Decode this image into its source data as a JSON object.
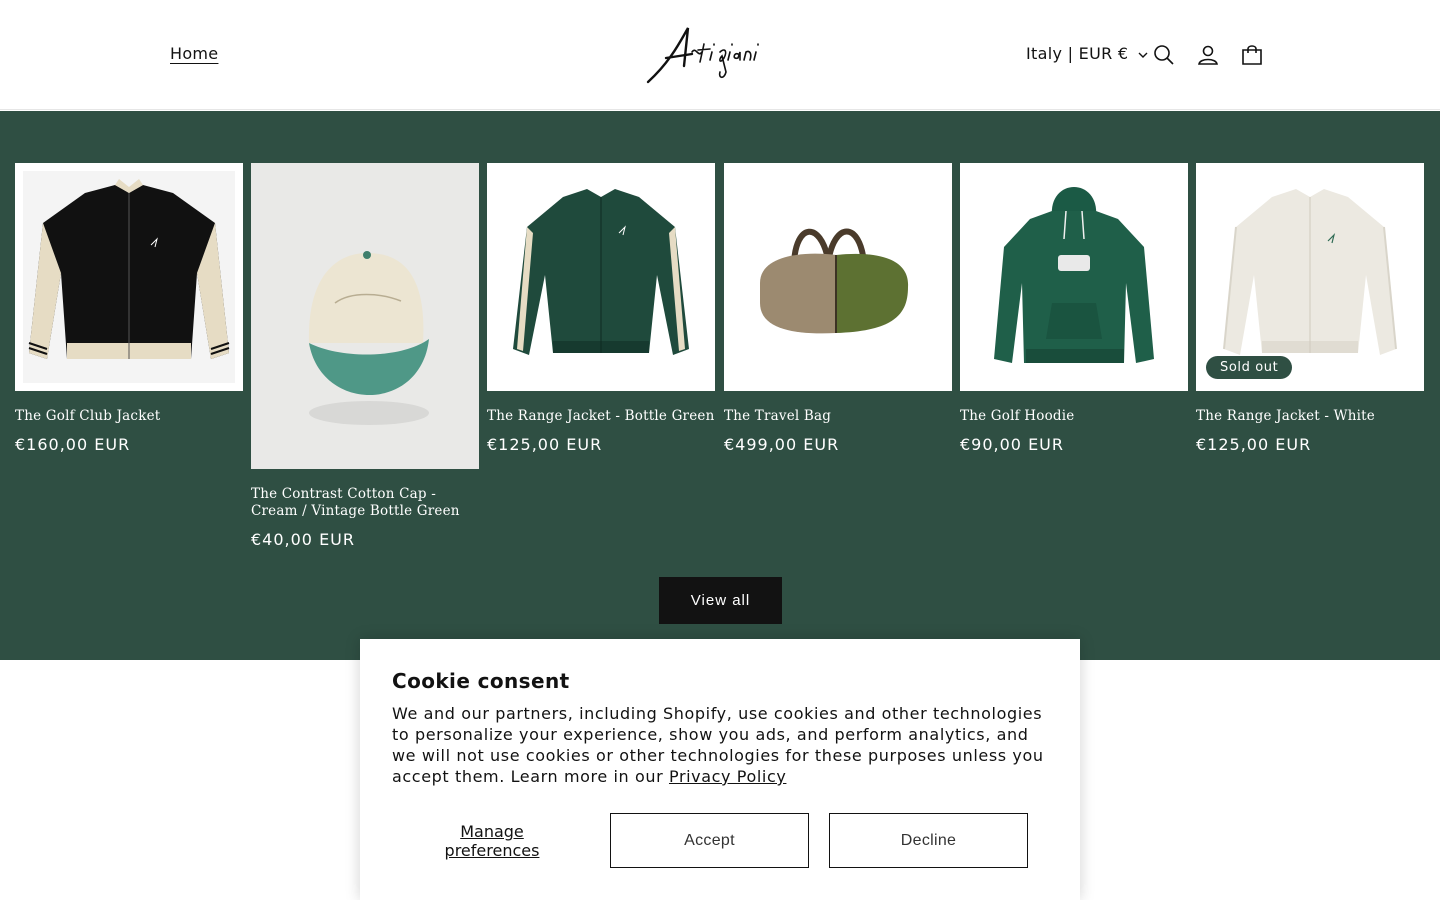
{
  "header": {
    "nav_home": "Home",
    "logo_text": "Artigiani",
    "locale": "Italy | EUR €",
    "icons": [
      "search-icon",
      "account-icon",
      "cart-icon"
    ]
  },
  "collection": {
    "background": "#2f4f43",
    "products": [
      {
        "title": "The Golf Club Jacket",
        "price": "€160,00 EUR"
      },
      {
        "title": "The Contrast Cotton Cap - Cream / Vintage Bottle Green",
        "price": "€40,00 EUR"
      },
      {
        "title": "The Range Jacket - Bottle Green",
        "price": "€125,00 EUR"
      },
      {
        "title": "The Travel Bag",
        "price": "€499,00 EUR"
      },
      {
        "title": "The Golf Hoodie",
        "price": "€90,00 EUR"
      },
      {
        "title": "The Range Jacket - White",
        "price": "€125,00 EUR",
        "badge": "Sold out"
      }
    ],
    "view_all": "View all"
  },
  "cookie": {
    "title": "Cookie consent",
    "body": "We and our partners, including Shopify, use cookies and other technologies to personalize your experience, show you ads, and perform analytics, and we will not use cookies or other technologies for these purposes unless you accept them. Learn more in our",
    "policy_link": "Privacy Policy",
    "manage": "Manage preferences",
    "accept": "Accept",
    "decline": "Decline"
  }
}
